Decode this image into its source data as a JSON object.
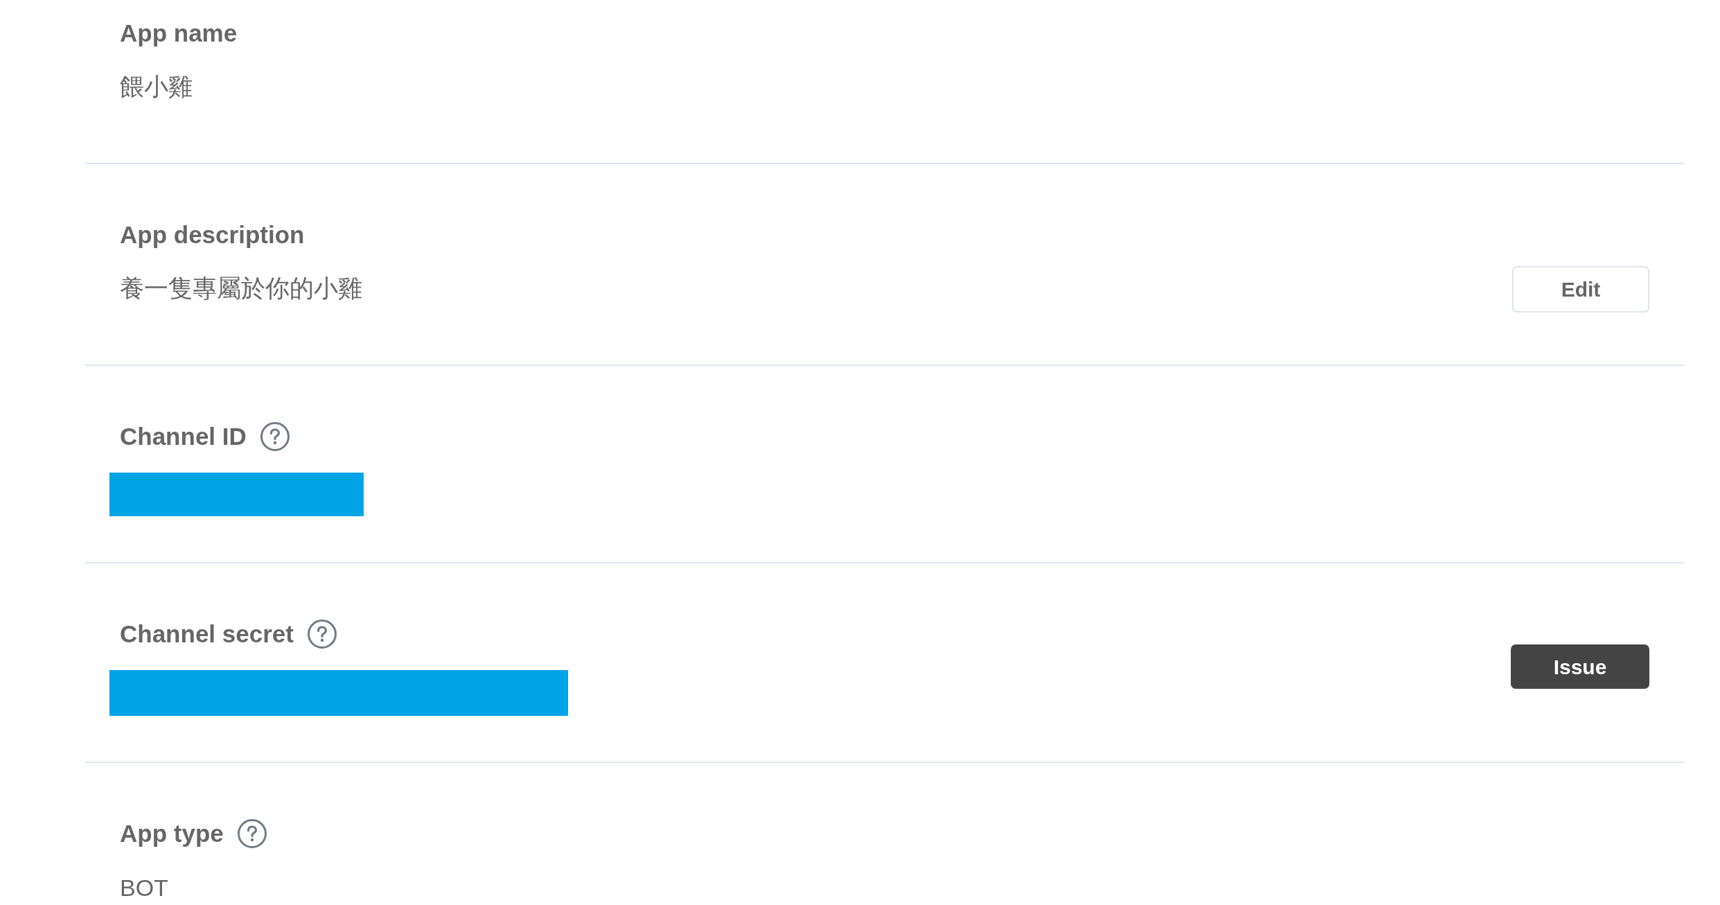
{
  "fields": [
    {
      "label": "App name",
      "help": false,
      "kind": "text",
      "value": "餵小雞"
    },
    {
      "label": "App description",
      "help": false,
      "kind": "text",
      "value": "養一隻專屬於你的小雞",
      "button": {
        "kind": "secondary",
        "label": "Edit"
      }
    },
    {
      "label": "Channel ID",
      "help": true,
      "kind": "redacted"
    },
    {
      "label": "Channel secret",
      "help": true,
      "kind": "redacted",
      "button": {
        "kind": "primary",
        "label": "Issue"
      }
    },
    {
      "label": "App type",
      "help": true,
      "kind": "text",
      "value": "BOT"
    }
  ]
}
